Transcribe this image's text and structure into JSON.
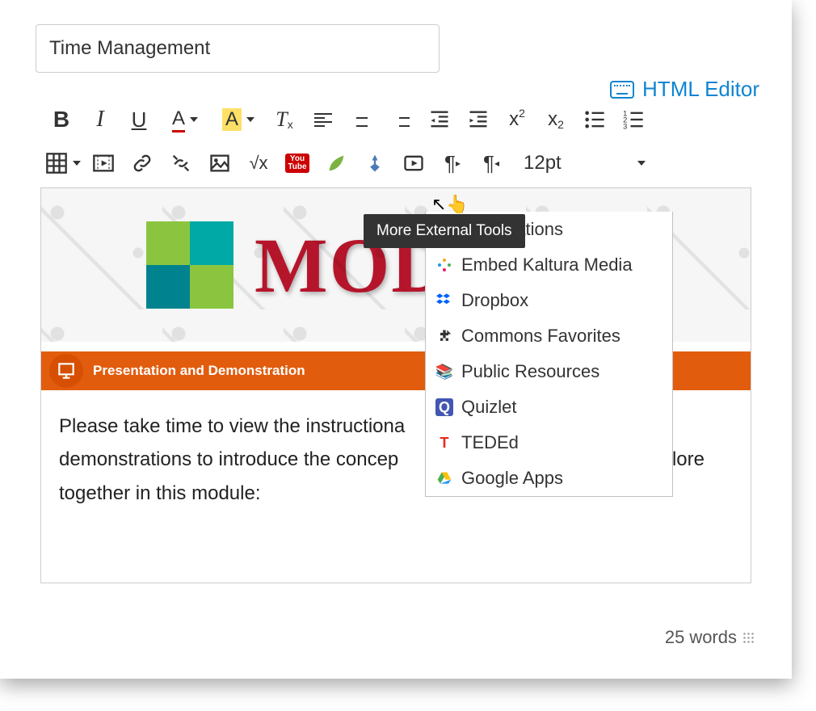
{
  "title_input": {
    "value": "Time Management"
  },
  "header": {
    "html_editor_label": "HTML Editor"
  },
  "toolbar": {
    "font_size": "12pt"
  },
  "tooltip": {
    "text": "More External Tools"
  },
  "dropdown": {
    "items": [
      {
        "label": "educreations"
      },
      {
        "label": "Embed Kaltura Media"
      },
      {
        "label": "Dropbox"
      },
      {
        "label": "Commons Favorites"
      },
      {
        "label": "Public Resources"
      },
      {
        "label": "Quizlet"
      },
      {
        "label": "TEDEd"
      },
      {
        "label": "Google Apps"
      }
    ]
  },
  "content": {
    "module_banner_text": "MODU",
    "section_label": "Presentation and Demonstration",
    "body_line1": "Please take time to view the instructiona",
    "body_line2": "demonstrations to introduce the concep",
    "body_line2_tail": "xplore",
    "body_line3": "together in this module:"
  },
  "footer": {
    "word_count": "25",
    "word_count_label": "words"
  }
}
